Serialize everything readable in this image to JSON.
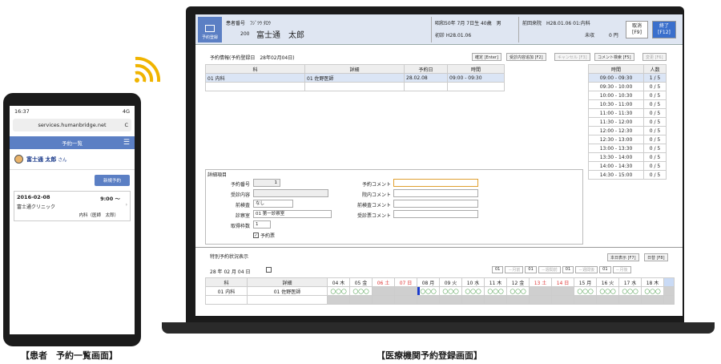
{
  "phone": {
    "time": "16:37",
    "signal": "4G",
    "url": "services.humanbridge.net",
    "reload": "C",
    "bar_title": "予約一覧",
    "menu": "☰",
    "user": "富士通 太郎",
    "san": "さん",
    "new_btn": "新規予約",
    "card": {
      "date": "2016-02-08",
      "time": "9:00 〜",
      "clinic": "富士通クリニック",
      "doctor": "内科（医師　太郎）",
      "arrow": "›"
    }
  },
  "laptop": {
    "logo": "予約登録",
    "patient": {
      "no_label": "患者番号",
      "kana": "ﾌｼﾞﾂｳ ﾀﾛｳ",
      "no": "200",
      "name": "富士通　太郎",
      "birth": "昭和50年 7月 7日生 40歳　男",
      "first": "初診 H28.01.06",
      "last": "前回来院　H28.01.06 01:内科",
      "unpaid": "未収　　　0 円"
    },
    "btn_cancel": "取消",
    "btn_cancel_key": "[F9]",
    "btn_end": "終了",
    "btn_end_key": "[F12]",
    "section_title": "予約情報(予約登録日　28年02月04日)",
    "top_buttons": [
      "確定 [Enter]",
      "受診内容追加 [F2]",
      "キャンセル [F3]",
      "コメント検索 [F5]",
      "変更 [F6]"
    ],
    "res_headers": [
      "科",
      "詳細",
      "予約日",
      "時間"
    ],
    "res_rows": [
      [
        "01 内科",
        "01 佐野医師",
        "28.02.08",
        "09:00 - 09:30"
      ]
    ],
    "slot_headers": [
      "時間",
      "人数"
    ],
    "slots": [
      [
        "09:00 - 09:30",
        "1 / 5"
      ],
      [
        "09:30 - 10:00",
        "0 / 5"
      ],
      [
        "10:00 - 10:30",
        "0 / 5"
      ],
      [
        "10:30 - 11:00",
        "0 / 5"
      ],
      [
        "11:00 - 11:30",
        "0 / 5"
      ],
      [
        "11:30 - 12:00",
        "0 / 5"
      ],
      [
        "12:00 - 12:30",
        "0 / 5"
      ],
      [
        "12:30 - 13:00",
        "0 / 5"
      ],
      [
        "13:00 - 13:30",
        "0 / 5"
      ],
      [
        "13:30 - 14:00",
        "0 / 5"
      ],
      [
        "14:00 - 14:30",
        "0 / 5"
      ],
      [
        "14:30 - 15:00",
        "0 / 5"
      ]
    ],
    "detail_title": "詳細項目",
    "detail": {
      "no_l": "予約番号",
      "no_v": "1",
      "content_l": "受診内容",
      "pre_l": "前検査",
      "pre_v": "なし",
      "room_l": "診察室",
      "room_v": "01 第一診察室",
      "frame_l": "取得枠数",
      "frame_v": "1",
      "card_v": "予約票",
      "c1": "予約コメント",
      "c2": "院内コメント",
      "c3": "前検査コメント",
      "c4": "受診票コメント"
    },
    "special_title": "特別予約状況表示",
    "btn_today": "本日表示 [F7]",
    "btn_day": "日替 [F8]",
    "date_nav": "28 年 02 月 04 日",
    "nav_items": [
      "01",
      "－月前",
      "01",
      "－週間前",
      "01",
      "－週間後",
      "01",
      "－月後"
    ],
    "cal_headers": [
      "科",
      "詳細"
    ],
    "cal_days": [
      [
        "04",
        "木"
      ],
      [
        "05",
        "金"
      ],
      [
        "06",
        "土"
      ],
      [
        "07",
        "日"
      ],
      [
        "08",
        "月"
      ],
      [
        "09",
        "火"
      ],
      [
        "10",
        "水"
      ],
      [
        "11",
        "木"
      ],
      [
        "12",
        "金"
      ],
      [
        "13",
        "土"
      ],
      [
        "14",
        "日"
      ],
      [
        "15",
        "月"
      ],
      [
        "16",
        "火"
      ],
      [
        "17",
        "水"
      ],
      [
        "18",
        "木"
      ]
    ],
    "cal_row": [
      "01 内科",
      "01 佐野医師"
    ],
    "cal_mark": "◯◯◯"
  },
  "captions": {
    "left": "【患者　予約一覧画面】",
    "right": "【医療機関予約登録画面】"
  }
}
